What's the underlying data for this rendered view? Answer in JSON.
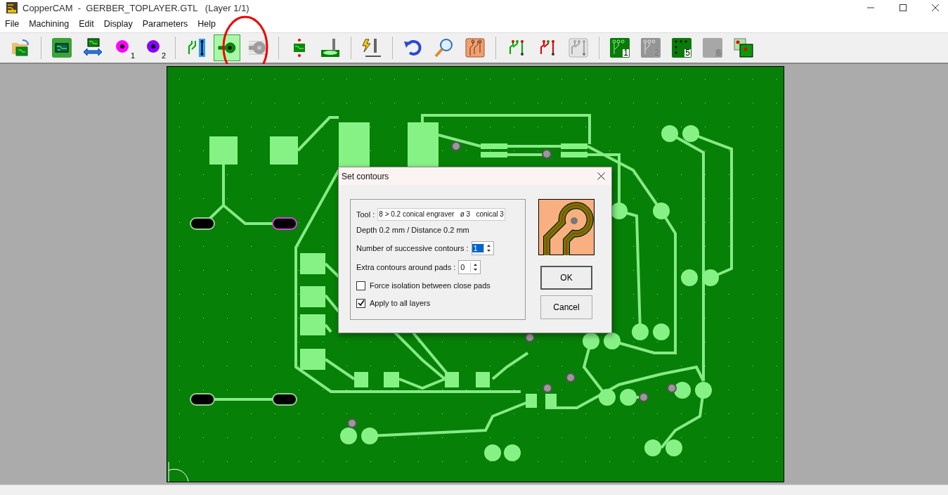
{
  "window": {
    "title": "CopperCAM  -  GERBER_TOPLAYER.GTL   (Layer 1/1)"
  },
  "menu": [
    "File",
    "Machining",
    "Edit",
    "Display",
    "Parameters",
    "Help"
  ],
  "toolbar": [
    {
      "kind": "open",
      "selected": false,
      "disabled": false
    },
    {
      "kind": "sep"
    },
    {
      "kind": "board",
      "selected": false,
      "disabled": false
    },
    {
      "kind": "swap",
      "selected": false,
      "disabled": false
    },
    {
      "kind": "drill-magenta",
      "badge": "1",
      "selected": false,
      "disabled": false
    },
    {
      "kind": "drill-violet",
      "badge": "2",
      "selected": false,
      "disabled": false
    },
    {
      "kind": "sep"
    },
    {
      "kind": "tracks",
      "selected": false,
      "disabled": false
    },
    {
      "kind": "contour",
      "selected": true,
      "disabled": false
    },
    {
      "kind": "hatch",
      "selected": false,
      "disabled": true
    },
    {
      "kind": "sep"
    },
    {
      "kind": "board-drill",
      "selected": false,
      "disabled": false
    },
    {
      "kind": "mill",
      "selected": false,
      "disabled": false
    },
    {
      "kind": "sep"
    },
    {
      "kind": "engrave",
      "selected": false,
      "disabled": false
    },
    {
      "kind": "sep"
    },
    {
      "kind": "undo",
      "selected": false,
      "disabled": false
    },
    {
      "kind": "magnify",
      "selected": false,
      "disabled": false
    },
    {
      "kind": "pcb-orange",
      "selected": false,
      "disabled": false
    },
    {
      "kind": "sep"
    },
    {
      "kind": "path-red",
      "selected": false,
      "disabled": false
    },
    {
      "kind": "path-mixed",
      "selected": false,
      "disabled": false
    },
    {
      "kind": "path-gray",
      "selected": false,
      "disabled": true
    },
    {
      "kind": "sep"
    },
    {
      "kind": "layer-tracks",
      "badge": "1",
      "selected": false,
      "disabled": false
    },
    {
      "kind": "layer-tracks",
      "badge": "2",
      "selected": false,
      "disabled": true
    },
    {
      "kind": "layer-dots",
      "badge": "5",
      "selected": false,
      "disabled": false
    },
    {
      "kind": "layer-blank",
      "badge": "6",
      "selected": false,
      "disabled": true
    },
    {
      "kind": "layer-overlay",
      "selected": false,
      "disabled": false
    }
  ],
  "dialog": {
    "title": "Set contours",
    "tool_label": "Tool :",
    "tool_value": "8 > 0.2 conical engraver   ø 3   conical 3",
    "depth_text": "Depth 0.2 mm  /  Distance 0.2 mm",
    "spinners": [
      {
        "label": "Number of successive contours :",
        "value": "1",
        "selected": true
      },
      {
        "label": "Extra contours around pads :",
        "value": "0",
        "selected": false
      }
    ],
    "checkboxes": [
      {
        "label": "Force isolation between close pads",
        "checked": false
      },
      {
        "label": "Apply to all layers",
        "checked": true
      }
    ],
    "buttons": [
      "OK",
      "Cancel"
    ]
  }
}
